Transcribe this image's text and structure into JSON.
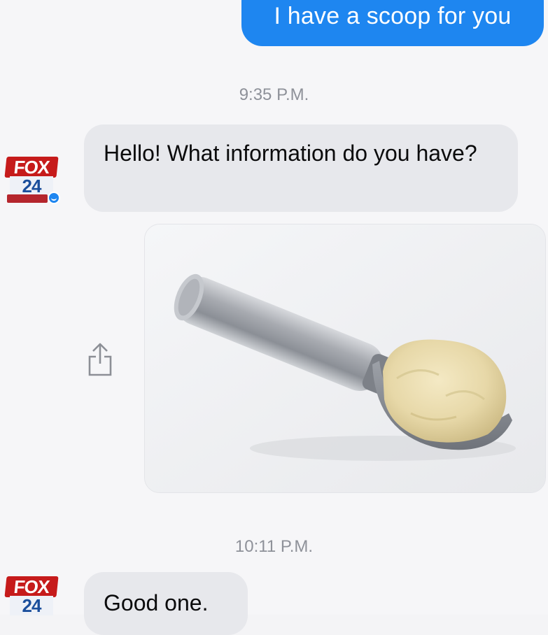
{
  "messages": {
    "sent_1": "I have a scoop for you",
    "time_1": "9:35 P.M.",
    "received_1": "Hello! What information do you have?",
    "time_2": "10:11 P.M.",
    "received_2": "Good one."
  },
  "avatar": {
    "fox_text": "FOX",
    "channel_number": "24"
  },
  "icons": {
    "share": "share-icon",
    "attachment_image": "ice-cream-scoop-photo"
  },
  "colors": {
    "sent_bubble": "#1e86f0",
    "received_bubble": "#e7e8ec",
    "background": "#f6f6f8",
    "timestamp": "#8e9199",
    "fox_red": "#c61b1b",
    "fox_blue": "#1b4f9c"
  }
}
